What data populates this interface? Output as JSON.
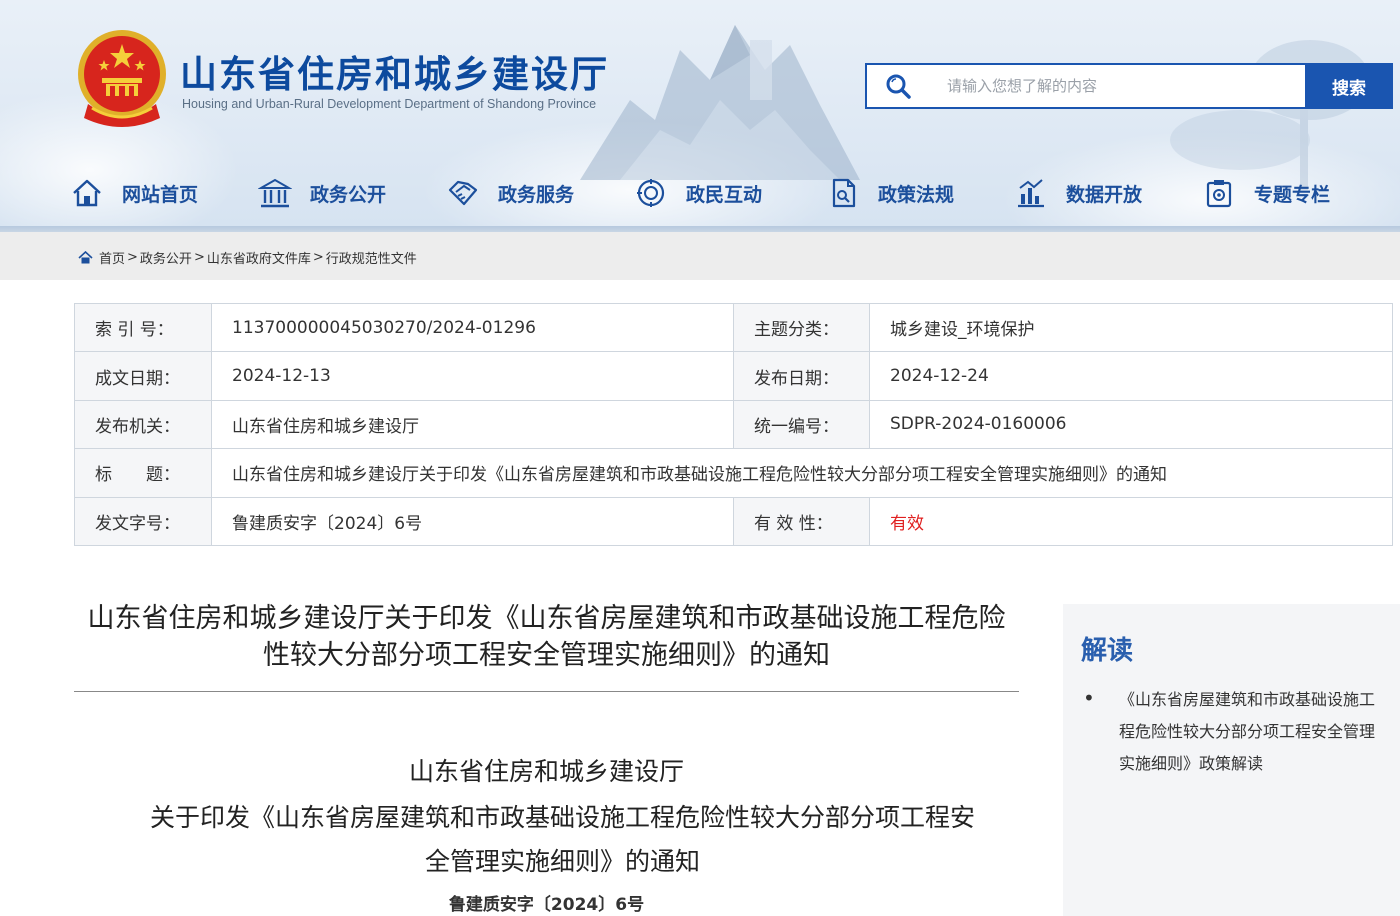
{
  "header": {
    "site_title": "山东省住房和城乡建设厅",
    "site_subtitle": "Housing and Urban-Rural Development Department of Shandong Province",
    "search": {
      "placeholder": "请输入您想了解的内容",
      "button_label": "搜索"
    },
    "nav": [
      {
        "label": "网站首页",
        "icon": "home-icon"
      },
      {
        "label": "政务公开",
        "icon": "government-building-icon"
      },
      {
        "label": "政务服务",
        "icon": "handshake-icon"
      },
      {
        "label": "政民互动",
        "icon": "chat-icon"
      },
      {
        "label": "政策法规",
        "icon": "document-icon"
      },
      {
        "label": "数据开放",
        "icon": "data-chart-icon"
      },
      {
        "label": "专题专栏",
        "icon": "topic-icon"
      }
    ]
  },
  "breadcrumb": {
    "items": [
      "首页",
      "政务公开",
      "山东省政府文件库",
      "行政规范性文件"
    ],
    "separator": ">"
  },
  "meta": {
    "rows": [
      {
        "label1": "索 引 号：",
        "value1": "113700000045030270/2024-01296",
        "label2": "主题分类：",
        "value2": "城乡建设_环境保护"
      },
      {
        "label1": "成文日期：",
        "value1": "2024-12-13",
        "label2": "发布日期：",
        "value2": "2024-12-24"
      },
      {
        "label1": "发布机关：",
        "value1": "山东省住房和城乡建设厅",
        "label2": "统一编号：",
        "value2": "SDPR-2024-0160006"
      },
      {
        "label1": "标　　题：",
        "value1": "山东省住房和城乡建设厅关于印发《山东省房屋建筑和市政基础设施工程危险性较大分部分项工程安全管理实施细则》的通知"
      },
      {
        "label1": "发文字号：",
        "value1": "鲁建质安字〔2024〕6号",
        "label2": "有 效 性：",
        "value2": "有效"
      }
    ],
    "valid_color": "#e02020"
  },
  "article": {
    "title_line1": "山东省住房和城乡建设厅关于印发《山东省房屋建筑和市政基础设施工程危险",
    "title_line2": "性较大分部分项工程安全管理实施细则》的通知",
    "org": "山东省住房和城乡建设厅",
    "doc_title_line1": "关于印发《山东省房屋建筑和市政基础设施工程危险性较大分部分项工程安",
    "doc_title_line2": "全管理实施细则》的通知",
    "doc_number": "鲁建质安字〔2024〕6号"
  },
  "sidebar": {
    "title": "解读",
    "items": [
      {
        "text": "《山东省房屋建筑和市政基础设施工程危险性较大分部分项工程安全管理实施细则》政策解读"
      }
    ]
  },
  "colors": {
    "brand_blue": "#1a55b0",
    "title_blue": "#0d4a9e",
    "nav_blue": "#1c4f9c"
  }
}
